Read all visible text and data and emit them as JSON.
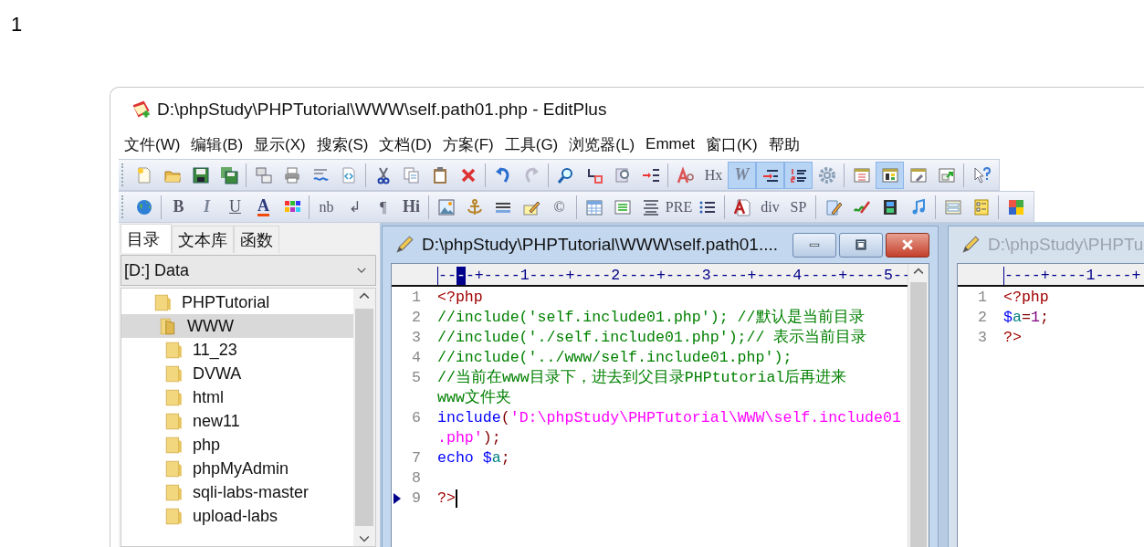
{
  "page_number": "1",
  "window": {
    "title": "D:\\phpStudy\\PHPTutorial\\WWW\\self.path01.php - EditPlus"
  },
  "menu": [
    "文件(W)",
    "编辑(B)",
    "显示(X)",
    "搜索(S)",
    "文档(D)",
    "方案(F)",
    "工具(G)",
    "浏览器(L)",
    "Emmet",
    "窗口(K)",
    "帮助"
  ],
  "toolbars": [
    [
      {
        "kind": "icon",
        "pressed": false
      },
      {
        "kind": "icon",
        "pressed": false
      },
      {
        "kind": "icon",
        "pressed": false
      },
      {
        "kind": "icon",
        "pressed": false
      },
      {
        "kind": "separator"
      },
      {
        "kind": "icon",
        "pressed": false
      },
      {
        "kind": "icon",
        "pressed": false
      },
      {
        "kind": "icon",
        "pressed": false
      },
      {
        "kind": "icon",
        "pressed": false
      },
      {
        "kind": "separator"
      },
      {
        "kind": "icon",
        "pressed": false
      },
      {
        "kind": "icon",
        "pressed": false
      },
      {
        "kind": "icon",
        "pressed": false
      },
      {
        "kind": "icon",
        "pressed": false
      },
      {
        "kind": "separator"
      },
      {
        "kind": "icon",
        "pressed": false
      },
      {
        "kind": "icon",
        "pressed": false
      },
      {
        "kind": "separator"
      },
      {
        "kind": "icon",
        "pressed": false
      },
      {
        "kind": "icon",
        "pressed": false
      },
      {
        "kind": "icon",
        "pressed": false
      },
      {
        "kind": "icon",
        "pressed": false
      },
      {
        "kind": "separator"
      },
      {
        "kind": "icon",
        "pressed": false
      },
      {
        "kind": "label",
        "label": "Hx",
        "pressed": false
      },
      {
        "kind": "italic",
        "label": "W",
        "pressed": true
      },
      {
        "kind": "icon",
        "pressed": true
      },
      {
        "kind": "icon",
        "pressed": true
      },
      {
        "kind": "icon",
        "pressed": false
      },
      {
        "kind": "separator"
      },
      {
        "kind": "icon",
        "pressed": false
      },
      {
        "kind": "icon",
        "pressed": true
      },
      {
        "kind": "icon",
        "pressed": false
      },
      {
        "kind": "icon",
        "pressed": false
      },
      {
        "kind": "separator"
      },
      {
        "kind": "icon",
        "pressed": false
      }
    ],
    [
      {
        "kind": "icon",
        "pressed": false
      },
      {
        "kind": "separator"
      },
      {
        "kind": "bold",
        "label": "B",
        "pressed": false
      },
      {
        "kind": "italic",
        "label": "I",
        "pressed": false
      },
      {
        "kind": "underline",
        "label": "U",
        "pressed": false
      },
      {
        "kind": "colortext",
        "label": "A",
        "pressed": false
      },
      {
        "kind": "icon",
        "pressed": false
      },
      {
        "kind": "separator"
      },
      {
        "kind": "label",
        "label": "nb",
        "pressed": false
      },
      {
        "kind": "label",
        "label": "↲",
        "pressed": false
      },
      {
        "kind": "label",
        "label": "¶",
        "pressed": false
      },
      {
        "kind": "bold",
        "label": "Hi",
        "pressed": false
      },
      {
        "kind": "separator"
      },
      {
        "kind": "icon",
        "pressed": false
      },
      {
        "kind": "icon",
        "pressed": false
      },
      {
        "kind": "icon",
        "pressed": false
      },
      {
        "kind": "icon",
        "pressed": false
      },
      {
        "kind": "label",
        "label": "©",
        "pressed": false
      },
      {
        "kind": "separator"
      },
      {
        "kind": "icon",
        "pressed": false
      },
      {
        "kind": "icon",
        "pressed": false
      },
      {
        "kind": "icon",
        "pressed": false
      },
      {
        "kind": "label",
        "label": "PRE",
        "pressed": false
      },
      {
        "kind": "icon",
        "pressed": false
      },
      {
        "kind": "separator"
      },
      {
        "kind": "icon",
        "pressed": false
      },
      {
        "kind": "label",
        "label": "div",
        "pressed": false
      },
      {
        "kind": "label",
        "label": "SP",
        "pressed": false
      },
      {
        "kind": "separator"
      },
      {
        "kind": "icon",
        "pressed": false
      },
      {
        "kind": "icon",
        "pressed": false
      },
      {
        "kind": "icon",
        "pressed": false
      },
      {
        "kind": "icon",
        "pressed": false
      },
      {
        "kind": "separator"
      },
      {
        "kind": "icon",
        "pressed": false
      },
      {
        "kind": "icon",
        "pressed": false
      },
      {
        "kind": "separator"
      },
      {
        "kind": "icon",
        "pressed": false
      }
    ]
  ],
  "sidebar": {
    "tabs": [
      {
        "label": "目录",
        "selected": true
      },
      {
        "label": "文本库",
        "selected": false
      },
      {
        "label": "函数",
        "selected": false
      }
    ],
    "drive": "[D:] Data",
    "tree": [
      {
        "label": "PHPTutorial",
        "selected": false,
        "children": [
          {
            "label": "WWW",
            "selected": true,
            "children": [
              {
                "label": "11_23",
                "selected": false
              },
              {
                "label": "DVWA",
                "selected": false
              },
              {
                "label": "html",
                "selected": false
              },
              {
                "label": "new11",
                "selected": false
              },
              {
                "label": "php",
                "selected": false
              },
              {
                "label": "phpMyAdmin",
                "selected": false
              },
              {
                "label": "sqli-labs-master",
                "selected": false
              },
              {
                "label": "upload-labs",
                "selected": false
              }
            ]
          }
        ]
      }
    ]
  },
  "editors": [
    {
      "title": "D:\\phpStudy\\PHPTutorial\\WWW\\self.path01....",
      "active": true,
      "ruler": [
        {
          "text": "--",
          "kind": "plain"
        },
        {
          "text": "-",
          "kind": "cursor"
        },
        {
          "text": "-+----1----+----2----+----3----+----4----+----5--",
          "kind": "plain"
        }
      ],
      "lines": [
        {
          "number": "1",
          "current": false,
          "parts": [
            {
              "tokens": [
                {
                  "text": "<?php",
                  "kind": "tag"
                }
              ]
            }
          ]
        },
        {
          "number": "2",
          "current": false,
          "parts": [
            {
              "tokens": [
                {
                  "text": "//include('self.include01.php'); //默认是当前目录",
                  "kind": "comment"
                }
              ]
            }
          ]
        },
        {
          "number": "3",
          "current": false,
          "parts": [
            {
              "tokens": [
                {
                  "text": "//include('./self.include01.php');// 表示当前目录",
                  "kind": "comment"
                }
              ]
            }
          ]
        },
        {
          "number": "4",
          "current": false,
          "parts": [
            {
              "tokens": [
                {
                  "text": "//include('../www/self.include01.php');",
                  "kind": "comment"
                }
              ]
            }
          ]
        },
        {
          "number": "5",
          "current": false,
          "parts": [
            {
              "tokens": [
                {
                  "text": "//当前在www目录下，进去到父目录PHPtutorial后再进来",
                  "kind": "comment"
                }
              ]
            },
            {
              "tokens": [
                {
                  "text": "www文件夹",
                  "kind": "comment"
                }
              ]
            }
          ]
        },
        {
          "number": "6",
          "current": false,
          "parts": [
            {
              "tokens": [
                {
                  "text": "include",
                  "kind": "keyword"
                },
                {
                  "text": "(",
                  "kind": "punct"
                },
                {
                  "text": "'D:\\phpStudy\\PHPTutorial\\WWW\\self.include01",
                  "kind": "string"
                }
              ]
            },
            {
              "tokens": [
                {
                  "text": ".php'",
                  "kind": "string"
                },
                {
                  "text": ");",
                  "kind": "punct"
                }
              ]
            }
          ]
        },
        {
          "number": "7",
          "current": false,
          "parts": [
            {
              "tokens": [
                {
                  "text": "echo ",
                  "kind": "keyword"
                },
                {
                  "text": "$",
                  "kind": "sign"
                },
                {
                  "text": "a",
                  "kind": "variable"
                },
                {
                  "text": ";",
                  "kind": "punct"
                }
              ]
            }
          ]
        },
        {
          "number": "8",
          "current": false
        },
        {
          "number": "9",
          "current": true,
          "parts": [
            {
              "tokens": [
                {
                  "text": "?>",
                  "kind": "tag"
                }
              ]
            }
          ]
        }
      ]
    },
    {
      "title": "D:\\phpStudy\\PHPTu",
      "active": false,
      "ruler": [
        {
          "text": "----+----1----+",
          "kind": "plain"
        }
      ],
      "lines": [
        {
          "number": "1",
          "current": false,
          "parts": [
            {
              "tokens": [
                {
                  "text": "<?php",
                  "kind": "tag"
                }
              ]
            }
          ]
        },
        {
          "number": "2",
          "current": false,
          "parts": [
            {
              "tokens": [
                {
                  "text": "$",
                  "kind": "sign"
                },
                {
                  "text": "a",
                  "kind": "variable"
                },
                {
                  "text": "=",
                  "kind": "punct"
                },
                {
                  "text": "1",
                  "kind": "number"
                },
                {
                  "text": ";",
                  "kind": "punct"
                }
              ]
            }
          ]
        },
        {
          "number": "3",
          "current": false,
          "parts": [
            {
              "tokens": [
                {
                  "text": "?>",
                  "kind": "tag"
                }
              ]
            }
          ]
        }
      ]
    }
  ]
}
